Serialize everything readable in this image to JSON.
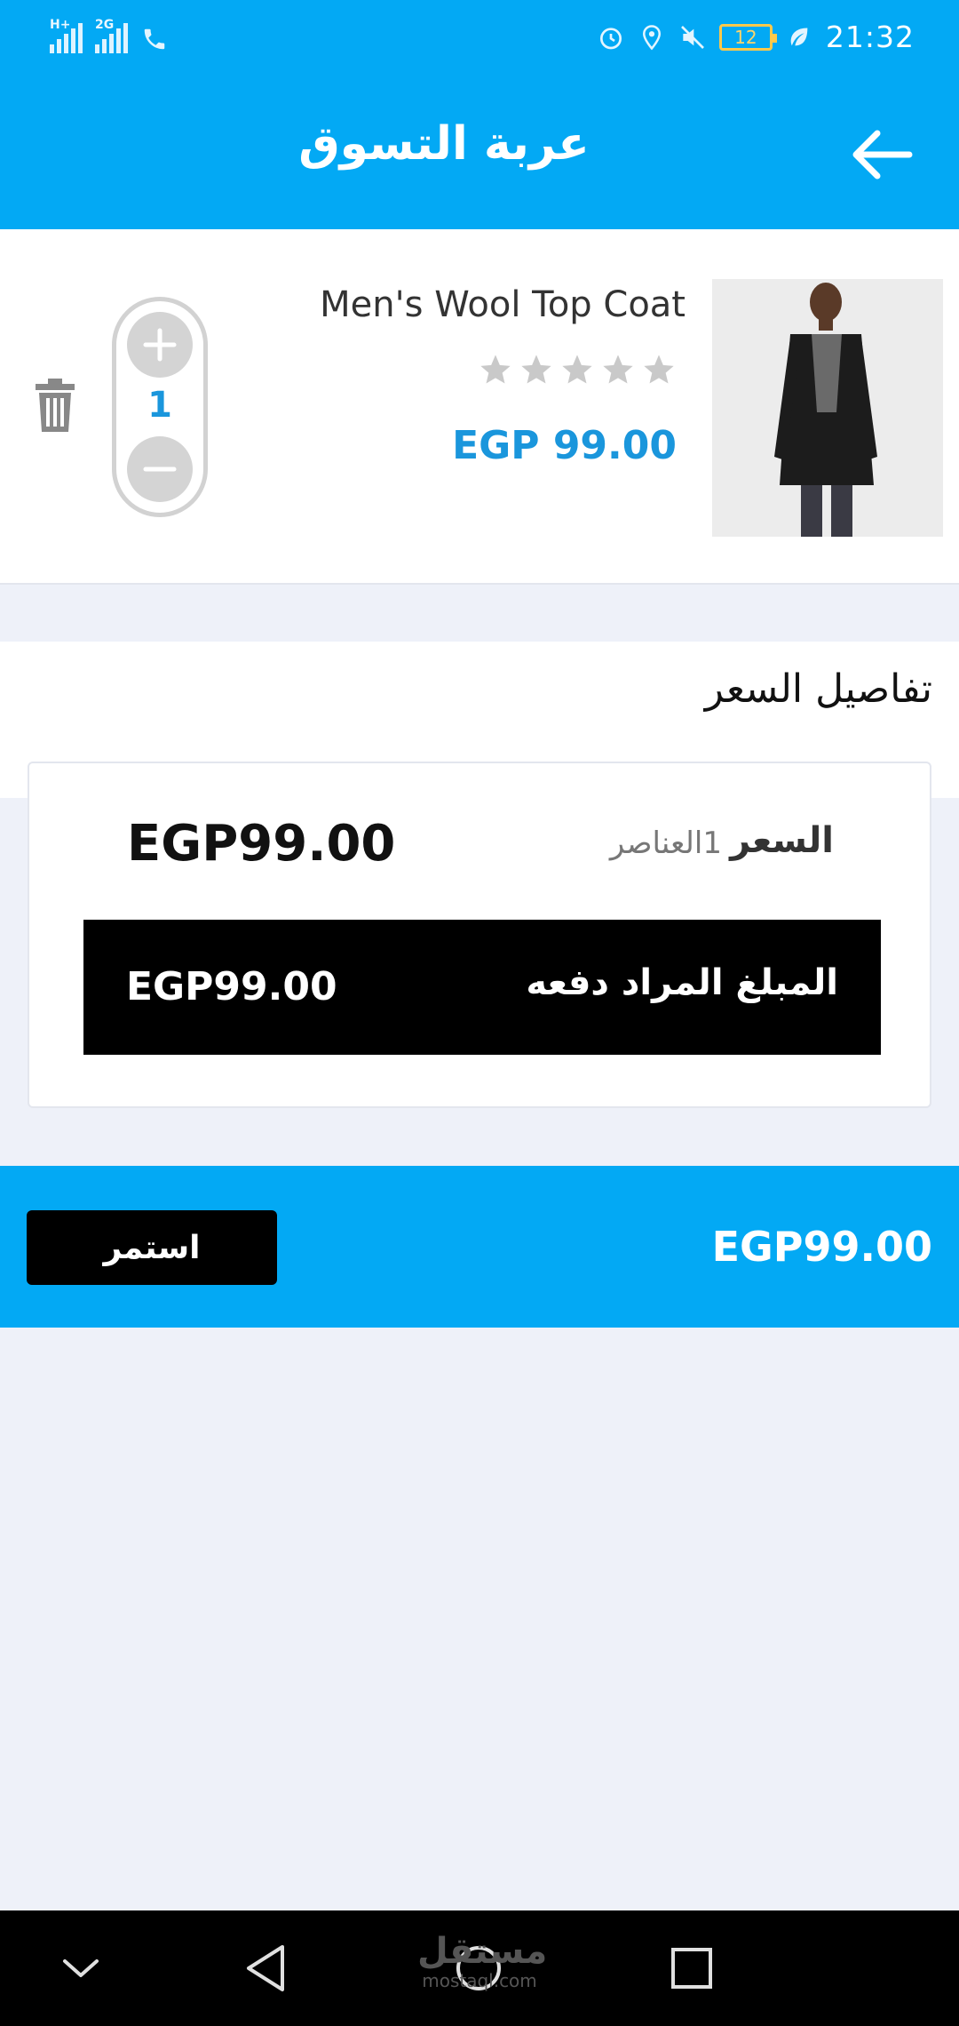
{
  "status_bar": {
    "network_1": "H+",
    "network_2": "2G",
    "battery": "12",
    "time": "21:32",
    "icons": [
      "call-icon",
      "alarm-icon",
      "location-icon",
      "mute-icon",
      "battery-icon",
      "leaf-icon"
    ]
  },
  "header": {
    "title": "عربة التسوق",
    "back_icon": "arrow-left-icon"
  },
  "cart": {
    "item": {
      "name": "Men's Wool Top Coat",
      "price": "EGP 99.00",
      "rating": 0,
      "rating_max": 5,
      "quantity": "1"
    }
  },
  "price_details": {
    "heading": "تفاصيل السعر",
    "price_label": "السعر",
    "items_count": "1العناصر",
    "price_value": "EGP99.00",
    "total_label": "المبلغ المراد دفعه",
    "total_value": "EGP99.00"
  },
  "checkout": {
    "total": "EGP99.00",
    "continue_label": "استمر"
  },
  "nav": {
    "watermark_ar": "مستقل",
    "watermark_en": "mostaql.com"
  },
  "colors": {
    "primary": "#03a9f4",
    "price_blue": "#1a96dc",
    "dark": "#000000",
    "background": "#eef1f9"
  }
}
